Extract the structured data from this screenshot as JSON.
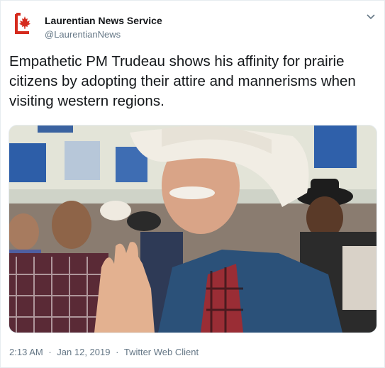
{
  "account": {
    "name": "Laurentian News Service",
    "handle": "@LaurentianNews",
    "avatar_icon": "maple-leaf-logo",
    "brand_color": "#d52b1e"
  },
  "tweet": {
    "text": "Empathetic PM Trudeau shows his affinity for prairie citizens by adopting their attire and mannerisms when visiting western regions.",
    "media_description_icon": "photo",
    "time": "2:13 AM",
    "date": "Jan 12, 2019",
    "source": "Twitter Web Client",
    "separator": "·"
  },
  "menu": {
    "caret_icon": "chevron-down-icon"
  }
}
